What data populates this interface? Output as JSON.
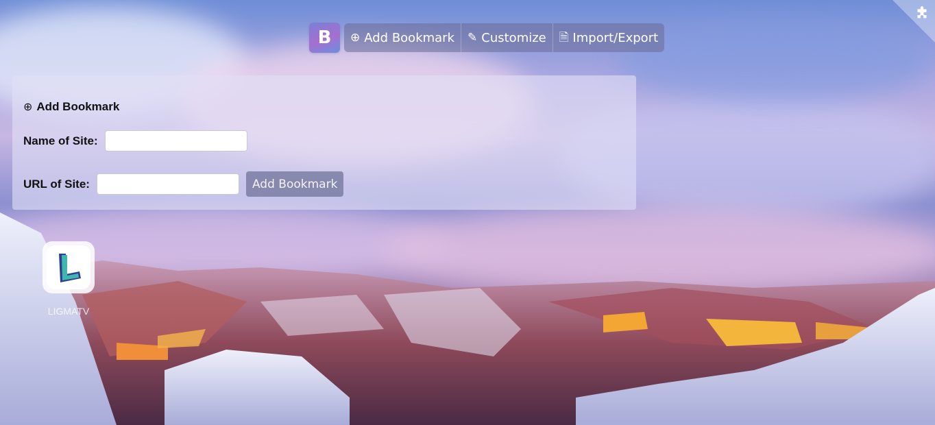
{
  "toolbar": {
    "logo_letter": "B",
    "add_bookmark": {
      "icon": "plus-circle-icon",
      "label": "Add Bookmark"
    },
    "customize": {
      "icon": "pencil-icon",
      "label": "Customize"
    },
    "import_export": {
      "icon": "file-icon",
      "label": "Import/Export"
    }
  },
  "corner": {
    "icon": "puzzle-icon"
  },
  "panel": {
    "title_icon": "plus-circle-icon",
    "title": "Add Bookmark",
    "name_label": "Name of Site:",
    "name_value": "",
    "url_label": "URL of Site:",
    "url_value": "",
    "submit_label": "Add Bookmark"
  },
  "shortcuts": [
    {
      "name": "LIGMATV",
      "icon": "ligmatv-logo"
    }
  ],
  "colors": {
    "accent_group": "#696c96",
    "logo_gradient_start": "#7b7fd6",
    "logo_gradient_end": "#a56fcf"
  }
}
